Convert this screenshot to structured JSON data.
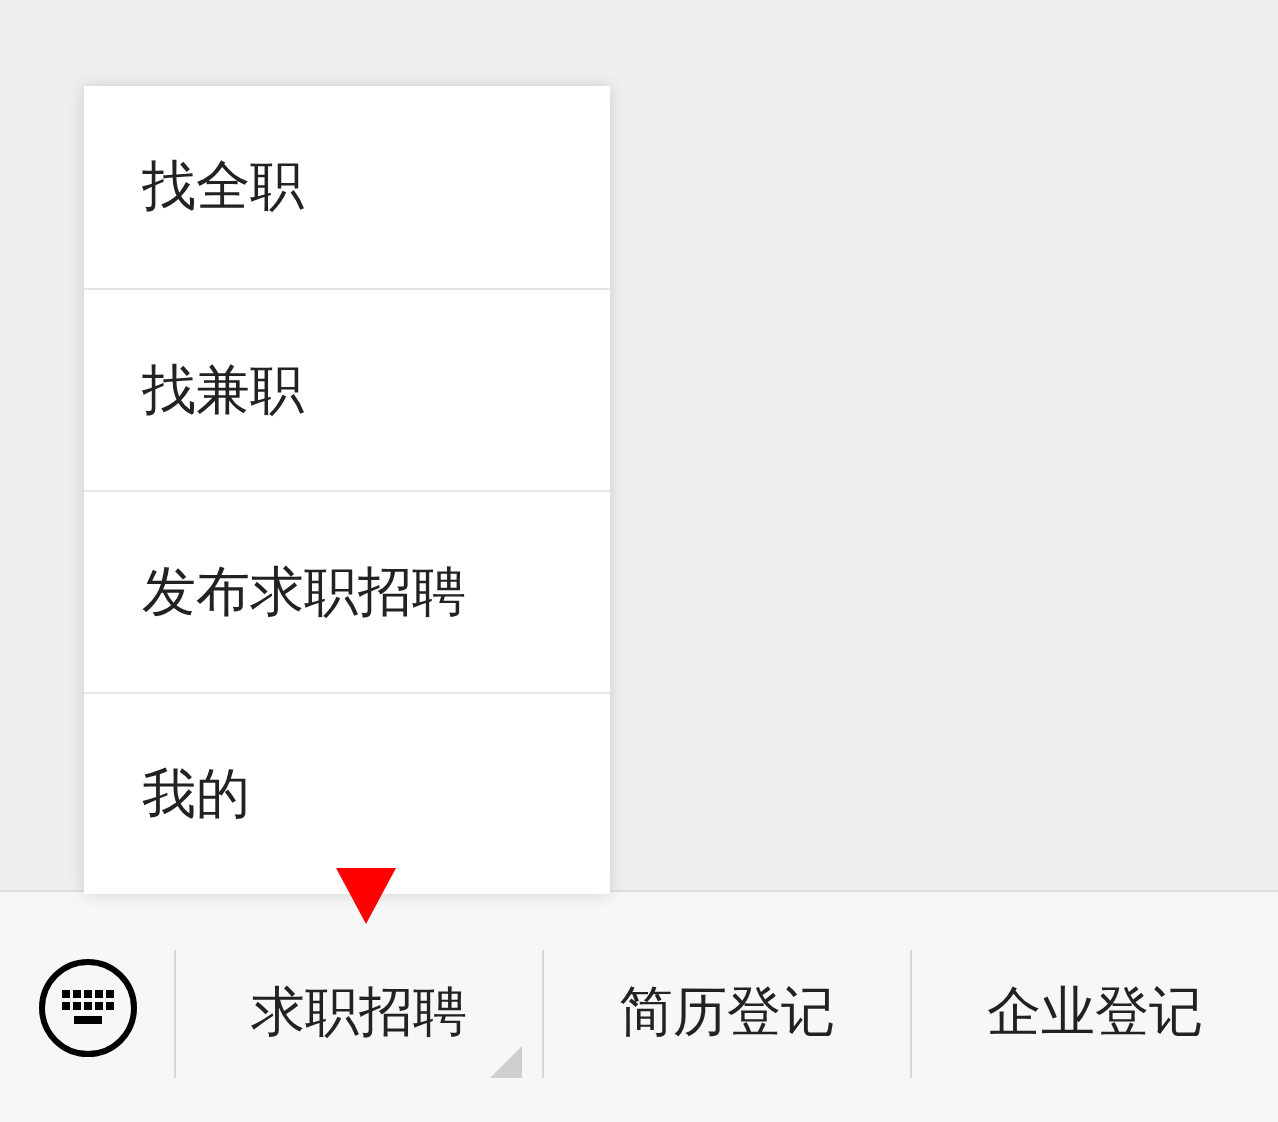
{
  "popup_menu": {
    "items": [
      {
        "label": "找全职"
      },
      {
        "label": "找兼职"
      },
      {
        "label": "发布求职招聘"
      },
      {
        "label": "我的"
      }
    ]
  },
  "menu_bar": {
    "tabs": [
      {
        "label": "求职招聘",
        "has_submenu": true
      },
      {
        "label": "简历登记",
        "has_submenu": false
      },
      {
        "label": "企业登记",
        "has_submenu": false
      }
    ]
  }
}
